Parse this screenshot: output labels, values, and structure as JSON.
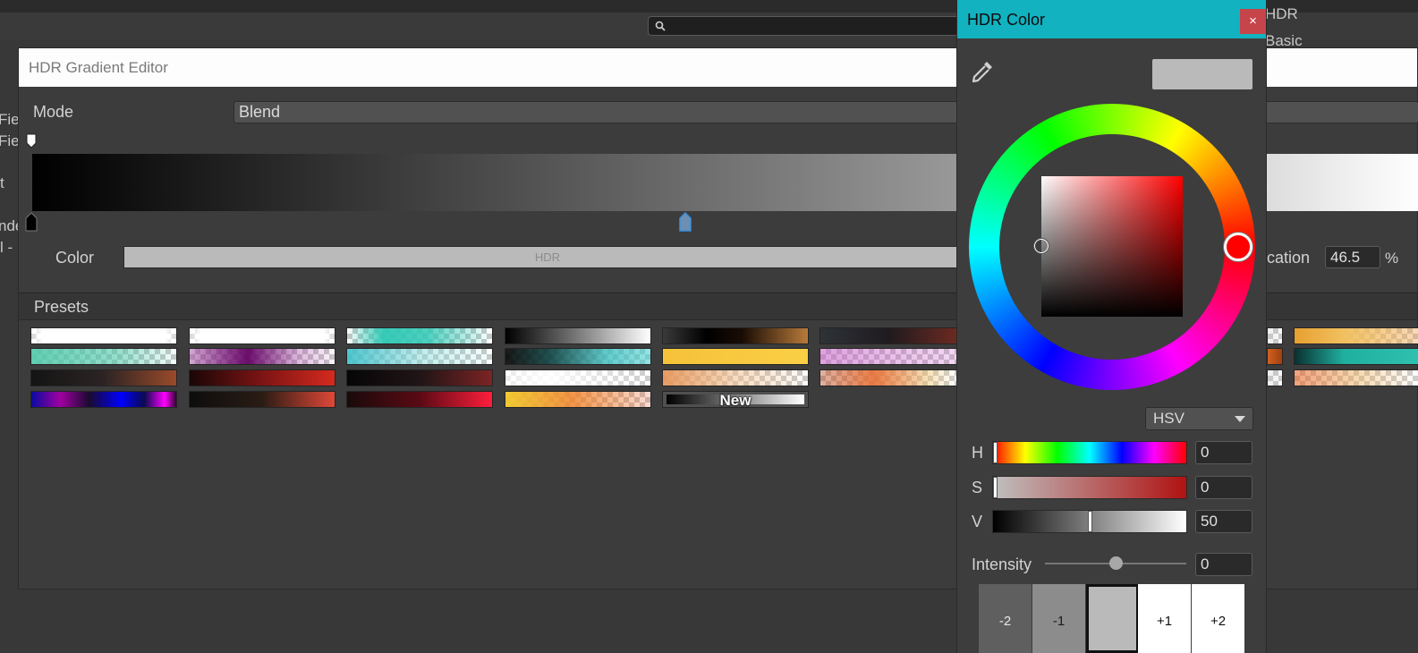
{
  "background": {
    "fragments": [
      "HDR",
      "Basic",
      "Fie",
      "Fie",
      "t",
      "nde",
      "l -"
    ]
  },
  "editor": {
    "title": "HDR Gradient Editor",
    "mode_label": "Mode",
    "mode_value": "Blend",
    "color_label": "Color",
    "color_field_text": "HDR",
    "location_label": "cation",
    "location_value": "46.5",
    "location_unit": "%",
    "presets_label": "Presets",
    "new_preset_label": "New"
  },
  "presets": [
    {
      "gradient": "linear-gradient(to right, rgba(255,255,255,0.2), #fff 8%, #fff 92%, rgba(255,255,255,0.2))",
      "alpha": true
    },
    {
      "gradient": "linear-gradient(to right, rgba(255,255,255,0.2), #fff 8%, #fff 92%, rgba(255,255,255,0.2))",
      "alpha": true
    },
    {
      "gradient": "linear-gradient(to right, rgba(45,200,180,0) 0%, rgba(45,200,180,0.95) 25%, rgba(45,200,180,0.85) 55%, rgba(45,200,180,0) 100%)",
      "alpha": true
    },
    {
      "gradient": "linear-gradient(to right, #000, #7a7a7a 50%, #fff)",
      "alpha": false
    },
    {
      "gradient": "linear-gradient(to right, #3a3a3a, #000 30%, #1a0d05 55%, #b87a3a)",
      "alpha": false
    },
    {
      "gradient": "linear-gradient(to right, #2e3338, #1f1a1f 50%, #6b2a20)",
      "alpha": false
    },
    {
      "gradient": "linear-gradient(to right, rgba(80,200,170,0.9), rgba(80,200,170,0.6) 60%, rgba(80,200,170,0.05))",
      "alpha": true
    },
    {
      "gradient": "linear-gradient(to right, rgba(170,80,170,0.5), rgba(100,0,100,0.95) 40%, rgba(170,80,170,0.4) 75%, rgba(170,80,170,0.05))",
      "alpha": true
    },
    {
      "gradient": "linear-gradient(to right, rgba(60,190,200,0.9), rgba(140,220,220,0.55) 50%, rgba(140,220,220,0.05))",
      "alpha": true
    },
    {
      "gradient": "linear-gradient(to right, rgba(0,0,0,0.9), rgba(10,60,60,0.9) 30%, rgba(60,190,190,0.8) 70%, rgba(80,210,210,0.6))",
      "alpha": true
    },
    {
      "gradient": "linear-gradient(to right, #f5c23a, #fbcf45)",
      "alpha": false
    },
    {
      "gradient": "linear-gradient(to right, rgba(200,100,200,0.6), rgba(200,100,200,0.25))",
      "alpha": true
    },
    {
      "gradient": "linear-gradient(to right, #141414, #2c2424 50%, #9a4a2a)",
      "alpha": false
    },
    {
      "gradient": "linear-gradient(to right, #1a0606, #7c1414 50%, #d42a1e)",
      "alpha": false
    },
    {
      "gradient": "linear-gradient(to right, #060606, #201416 50%, #7c2424)",
      "alpha": false
    },
    {
      "gradient": "linear-gradient(to right, rgba(255,255,255,0.6), rgba(255,255,255,0.95) 30%, rgba(255,255,255,0.05))",
      "alpha": true
    },
    {
      "gradient": "linear-gradient(to right, rgba(230,150,90,0.95), rgba(240,190,140,0.55) 50%, rgba(240,190,140,0.05))",
      "alpha": true
    },
    {
      "gradient": "linear-gradient(to right, rgba(180,60,20,0.4), rgba(230,110,50,0.9) 40%, rgba(240,200,120,0.5) 80%, rgba(255,255,255,0.1))",
      "alpha": true
    },
    {
      "gradient": "linear-gradient(to right, #0a0aa0, #a000a0 20%, #1a0a30 40%, #0000ff 62%, #0a0a50 78%, #ff00ff 92%, #330033)",
      "alpha": false
    },
    {
      "gradient": "linear-gradient(to right, #0d0d0d, #2a1c14 50%, #e04838)",
      "alpha": false
    },
    {
      "gradient": "linear-gradient(to right, #1a0a0a, #5a0a14 50%, #ff1e3c)",
      "alpha": false
    },
    {
      "gradient": "linear-gradient(to right, rgba(240,200,40,0.95), rgba(240,130,40,0.85) 45%, rgba(230,80,40,0.2))",
      "alpha": true
    }
  ],
  "picker": {
    "title": "HDR Color",
    "close_label": "×",
    "mode_value": "HSV",
    "h_label": "H",
    "h_value": "0",
    "s_label": "S",
    "s_value": "0",
    "v_label": "V",
    "v_value": "50",
    "intensity_label": "Intensity",
    "intensity_value": "0",
    "exposure_stops": [
      "-2",
      "-1",
      "",
      "+1",
      "+2"
    ]
  },
  "colors": {
    "picker_title_bar": "#12b2c0",
    "close_button": "#c6454a",
    "preview": "#bababa",
    "hue_handle": "#ff0000"
  }
}
